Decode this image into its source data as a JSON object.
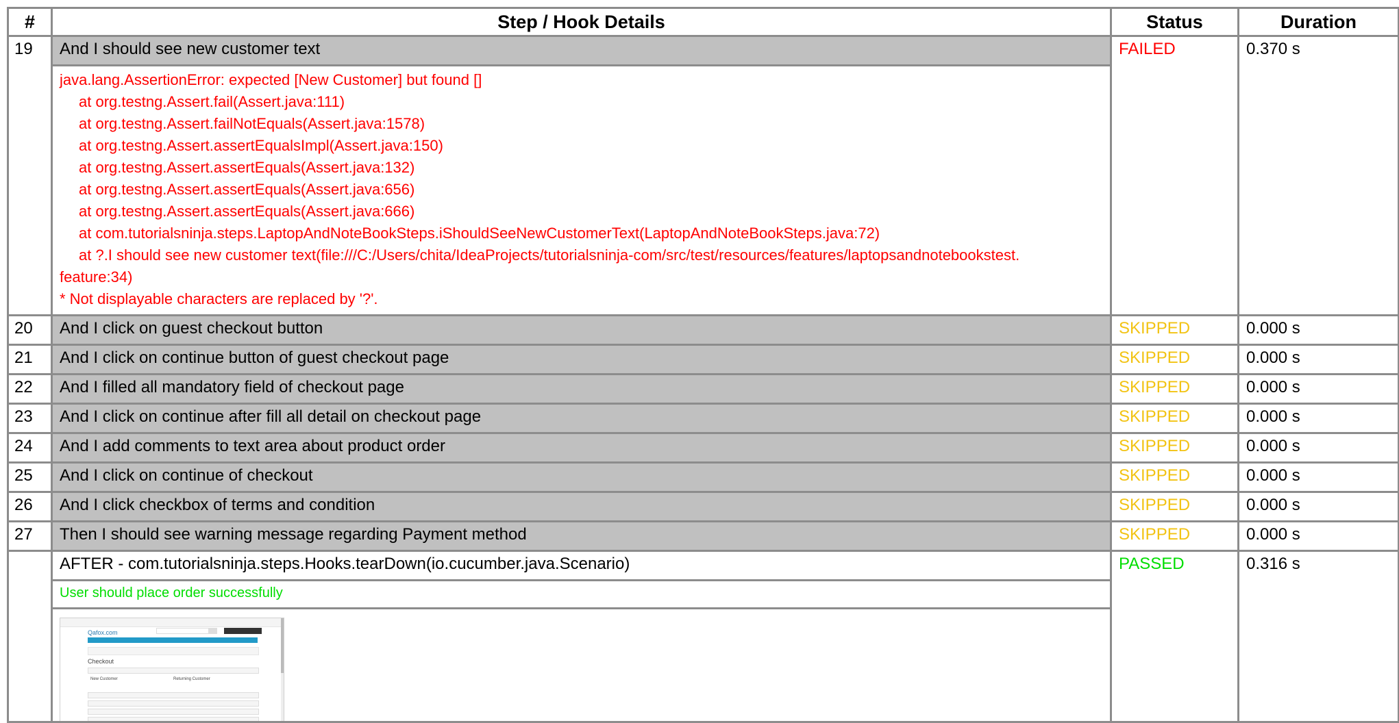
{
  "headers": {
    "num": "#",
    "details": "Step / Hook Details",
    "status": "Status",
    "duration": "Duration"
  },
  "failed_step": {
    "num": "19",
    "text": "And I should see new customer text",
    "status": "FAILED",
    "duration": "0.370 s",
    "error_lines": [
      "java.lang.AssertionError: expected [New Customer] but found []",
      "at org.testng.Assert.fail(Assert.java:111)",
      "at org.testng.Assert.failNotEquals(Assert.java:1578)",
      "at org.testng.Assert.assertEqualsImpl(Assert.java:150)",
      "at org.testng.Assert.assertEquals(Assert.java:132)",
      "at org.testng.Assert.assertEquals(Assert.java:656)",
      "at org.testng.Assert.assertEquals(Assert.java:666)",
      "at com.tutorialsninja.steps.LaptopAndNoteBookSteps.iShouldSeeNewCustomerText(LaptopAndNoteBookSteps.java:72)",
      "at ?.I should see new customer text(file:///C:/Users/chita/IdeaProjects/tutorialsninja-com/src/test/resources/features/laptopsandnotebookstest.",
      "feature:34)",
      "* Not displayable characters are replaced by '?'."
    ]
  },
  "skipped_steps": [
    {
      "num": "20",
      "text": "And I click on guest checkout button",
      "status": "SKIPPED",
      "duration": "0.000 s"
    },
    {
      "num": "21",
      "text": "And I click on continue button of guest checkout page",
      "status": "SKIPPED",
      "duration": "0.000 s"
    },
    {
      "num": "22",
      "text": "And I filled all mandatory field of checkout page",
      "status": "SKIPPED",
      "duration": "0.000 s"
    },
    {
      "num": "23",
      "text": "And I click on continue after fill all detail on checkout page",
      "status": "SKIPPED",
      "duration": "0.000 s"
    },
    {
      "num": "24",
      "text": "And I add comments to text area about product order",
      "status": "SKIPPED",
      "duration": "0.000 s"
    },
    {
      "num": "25",
      "text": "And I click on continue of checkout",
      "status": "SKIPPED",
      "duration": "0.000 s"
    },
    {
      "num": "26",
      "text": "And I click checkbox of terms and condition",
      "status": "SKIPPED",
      "duration": "0.000 s"
    },
    {
      "num": "27",
      "text": "Then I should see warning message regarding Payment method",
      "status": "SKIPPED",
      "duration": "0.000 s"
    }
  ],
  "hook": {
    "text": "AFTER - com.tutorialsninja.steps.Hooks.tearDown(io.cucumber.java.Scenario)",
    "status": "PASSED",
    "duration": "0.316 s",
    "message": "User should place order successfully"
  },
  "screenshot": {
    "brand": "Qafox.com",
    "page_title": "Checkout",
    "new_customer": "New Customer",
    "returning_customer": "Returning Customer"
  },
  "colors": {
    "failed": "#ff0000",
    "skipped": "#f2c313",
    "passed": "#00dd00",
    "step_bg": "#c0c0c0",
    "border": "#8c8c8c"
  }
}
